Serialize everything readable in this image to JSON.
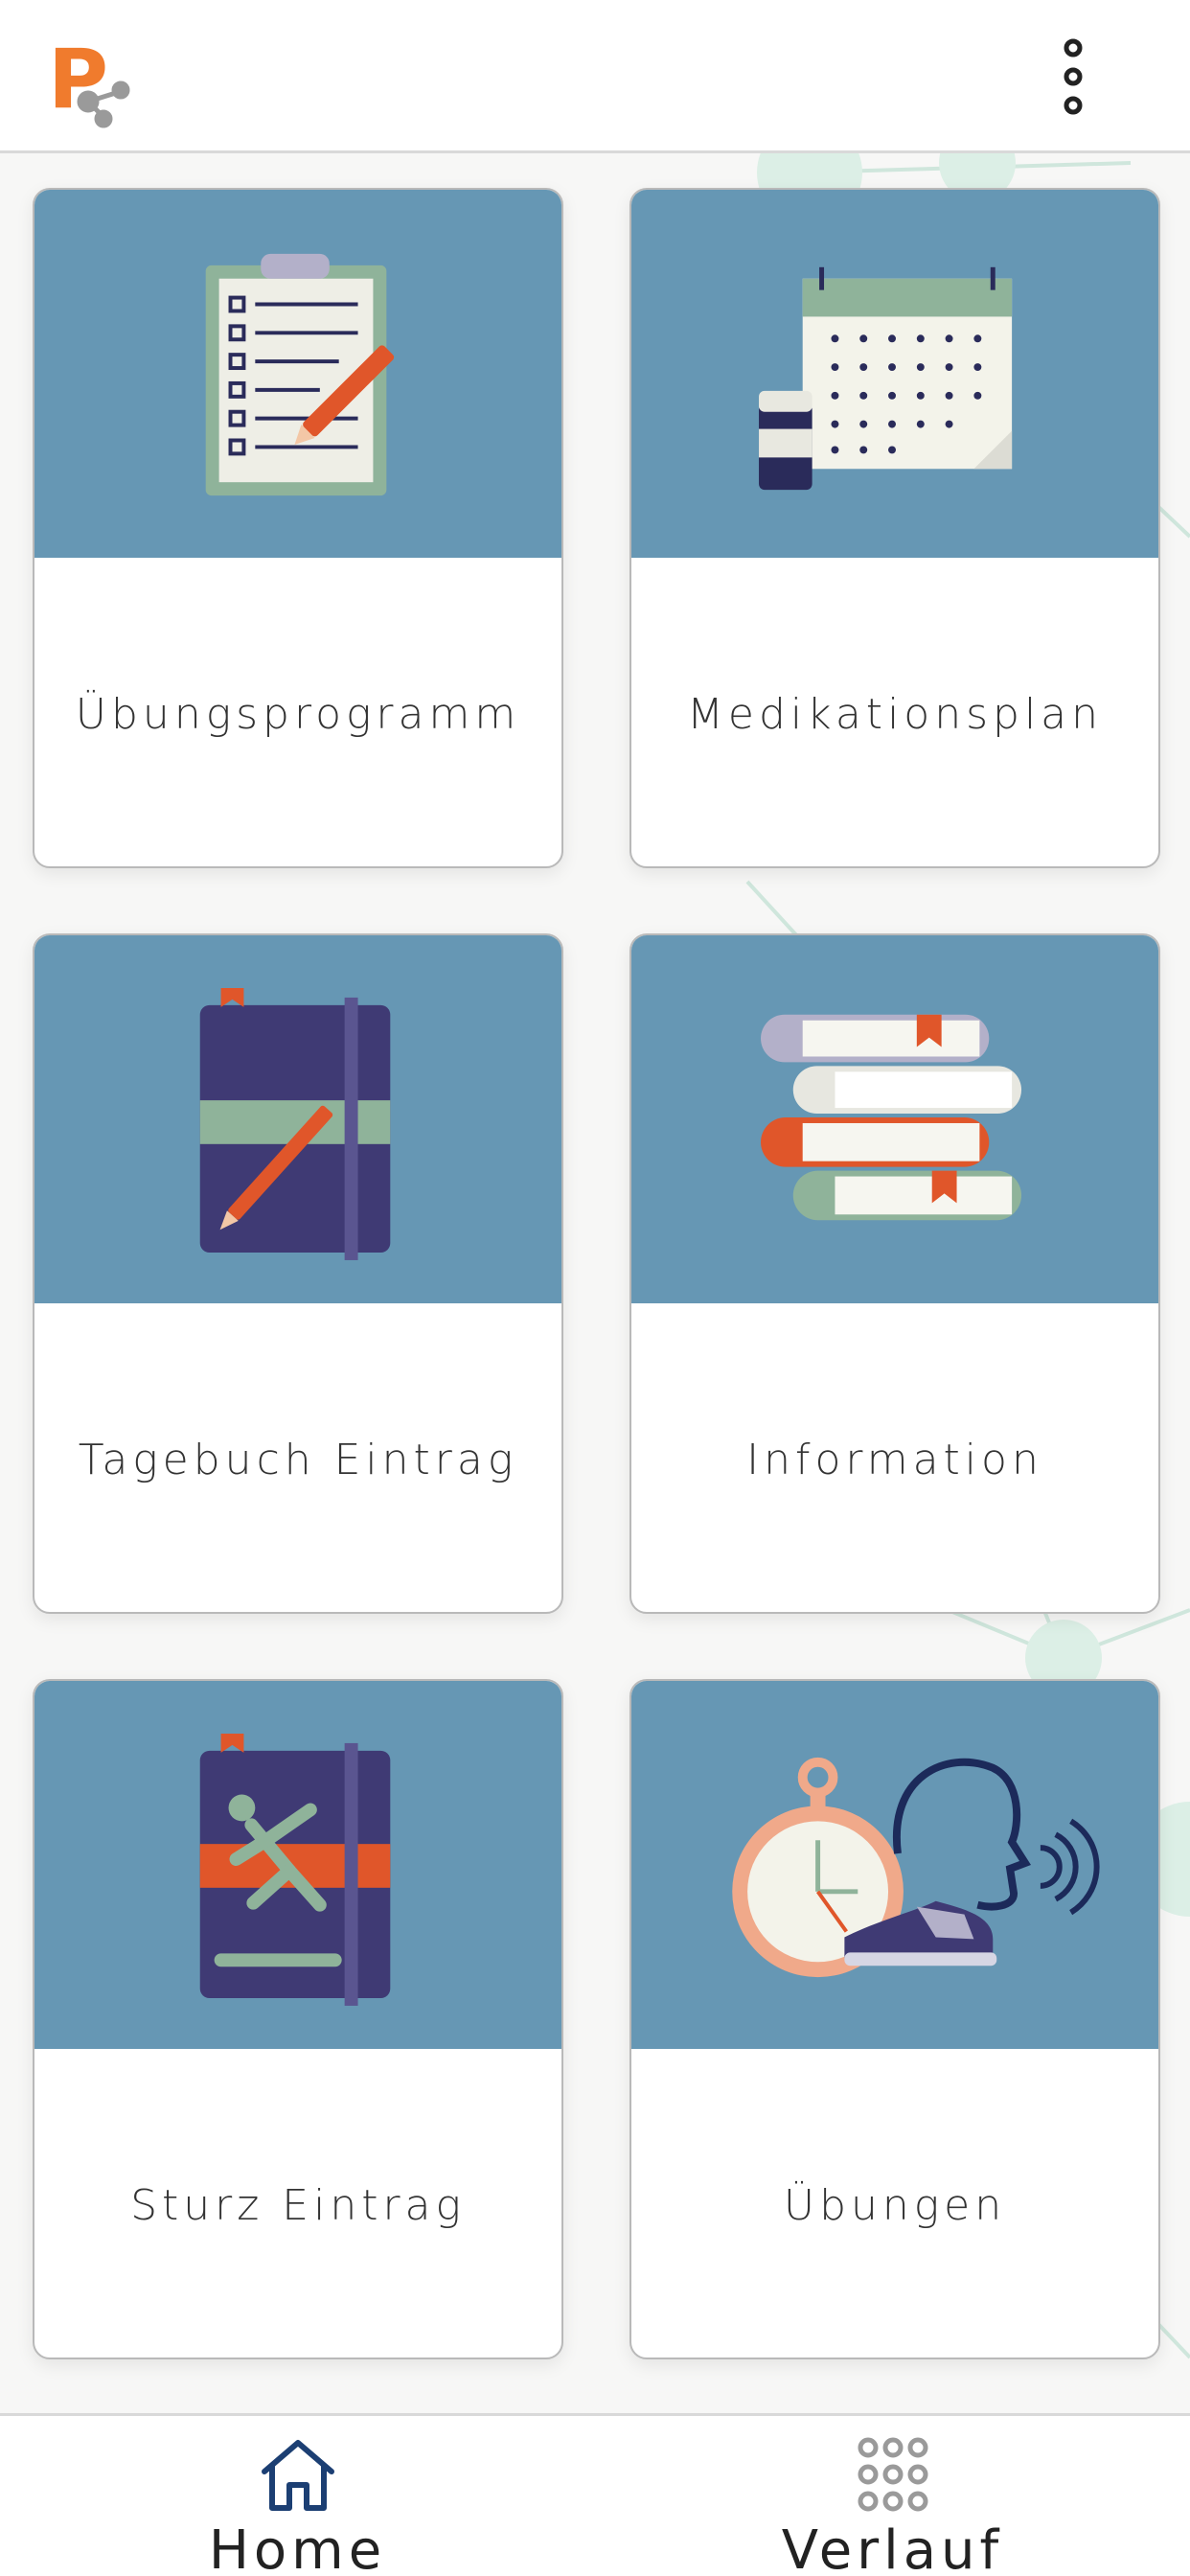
{
  "header": {
    "logo_letter": "P",
    "logo_color": "#f07b2d",
    "menu_icon": "more-vert-icon"
  },
  "cards": [
    {
      "label": "Übungsprogramm",
      "icon": "clipboard-checklist-icon"
    },
    {
      "label": "Medikationsplan",
      "icon": "calendar-pill-icon"
    },
    {
      "label": "Tagebuch Eintrag",
      "icon": "diary-pencil-icon"
    },
    {
      "label": "Information",
      "icon": "books-stack-icon"
    },
    {
      "label": "Sturz Eintrag",
      "icon": "fall-diary-icon"
    },
    {
      "label": "Übungen",
      "icon": "stopwatch-voice-shoe-icon"
    }
  ],
  "bottom_nav": {
    "items": [
      {
        "label": "Home",
        "icon": "home-icon",
        "active": true
      },
      {
        "label": "Verlauf",
        "icon": "grid-dots-icon",
        "active": false
      }
    ]
  },
  "colors": {
    "card_image_bg": "#6697b4",
    "accent_orange": "#e0562a",
    "navy": "#1c2a5a"
  }
}
